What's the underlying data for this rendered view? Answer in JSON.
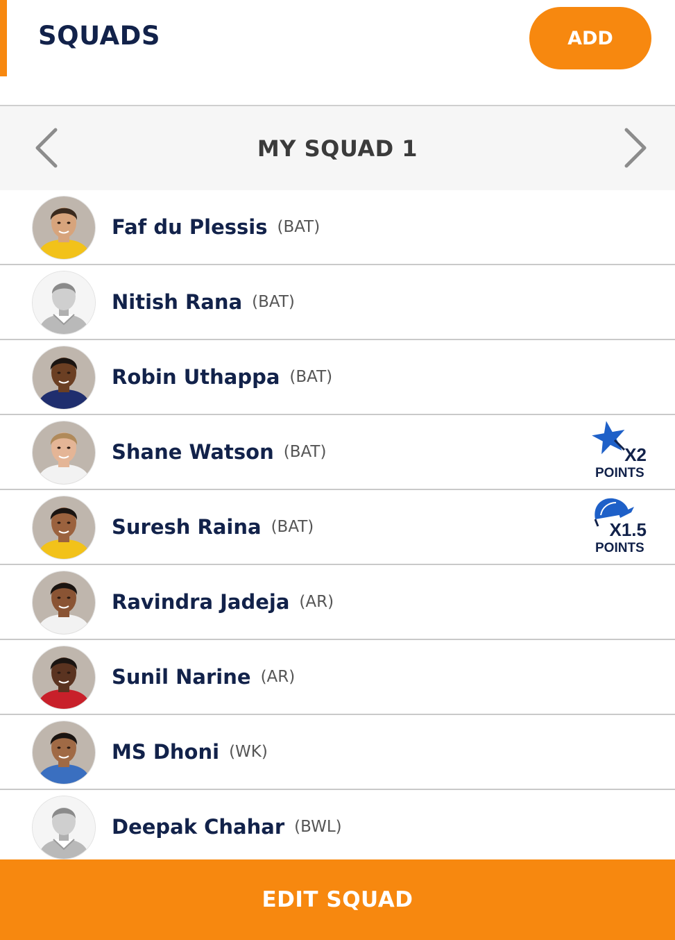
{
  "header": {
    "title": "SQUADS",
    "add_label": "ADD"
  },
  "squad_nav": {
    "name": "MY SQUAD 1",
    "prev_icon": "chevron-left-icon",
    "next_icon": "chevron-right-icon"
  },
  "players": [
    {
      "name": "Faf du Plessis",
      "role": "(BAT)",
      "avatar": "photo",
      "skin": "#d7a47c",
      "hair": "#3a2a1e",
      "shirt": "#f2c21a"
    },
    {
      "name": "Nitish Rana",
      "role": "(BAT)",
      "avatar": "placeholder"
    },
    {
      "name": "Robin Uthappa",
      "role": "(BAT)",
      "avatar": "photo",
      "skin": "#6b3f23",
      "hair": "#1a1411",
      "shirt": "#1f2e6e"
    },
    {
      "name": "Shane Watson",
      "role": "(BAT)",
      "avatar": "photo",
      "skin": "#e4b596",
      "hair": "#b08a5a",
      "shirt": "#f2f2f2",
      "badge": {
        "icon": "star-icon",
        "multiplier": "X2",
        "label": "POINTS"
      }
    },
    {
      "name": "Suresh Raina",
      "role": "(BAT)",
      "avatar": "photo",
      "skin": "#9b623e",
      "hair": "#1a1411",
      "shirt": "#f2c21a",
      "badge": {
        "icon": "cap-icon",
        "multiplier": "X1.5",
        "label": "POINTS"
      }
    },
    {
      "name": "Ravindra Jadeja",
      "role": "(AR)",
      "avatar": "photo",
      "skin": "#8a5434",
      "hair": "#1a1411",
      "shirt": "#f2f2f2"
    },
    {
      "name": "Sunil Narine",
      "role": "(AR)",
      "avatar": "photo",
      "skin": "#5a3320",
      "hair": "#1a1411",
      "shirt": "#c8202a"
    },
    {
      "name": "MS Dhoni",
      "role": "(WK)",
      "avatar": "photo",
      "skin": "#a06a45",
      "hair": "#1a1411",
      "shirt": "#3a6fc0"
    },
    {
      "name": "Deepak Chahar",
      "role": "(BWL)",
      "avatar": "placeholder"
    }
  ],
  "footer": {
    "edit_label": "EDIT SQUAD"
  },
  "colors": {
    "accent": "#f7880f",
    "navy": "#12224a",
    "badge_blue": "#1e60c8"
  }
}
